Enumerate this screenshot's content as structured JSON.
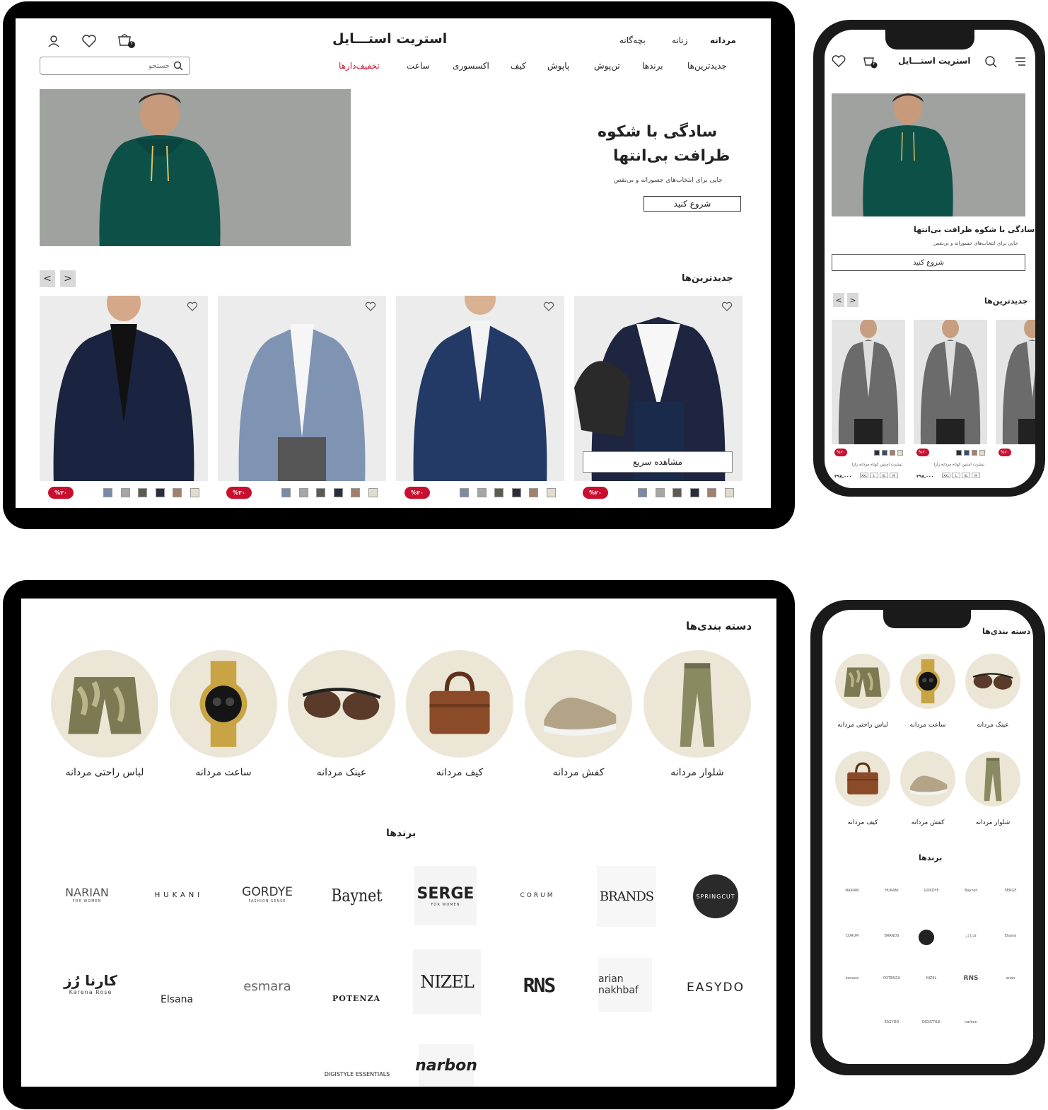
{
  "desktop": {
    "store_name": "استریت استـــایل",
    "top_nav": [
      "مردانه",
      "زنانه",
      "بچه‌گانه"
    ],
    "search_placeholder": "جستجو",
    "cart_count": "۲",
    "main_nav": [
      "جدیدترین‌ها",
      "برندها",
      "تن‌پوش",
      "پاپوش",
      "کیف",
      "اکسسوری",
      "ساعت",
      "تخفیف‌دارها"
    ],
    "hero": {
      "title_line1": "سادگی با شکوه",
      "title_line2": "ظرافت بی‌انتها",
      "subtitle": "جایی برای انتخاب‌های جسورانه و بی‌نقص",
      "cta": "شروع کنید"
    },
    "newest": {
      "heading": "جدیدترین‌ها",
      "prev": "<",
      "next": ">",
      "quick_view": "مشاهده سریع",
      "discount": "%۲۰",
      "swatch_colors": [
        "#7b8aa6",
        "#a6a6a6",
        "#5b5b52",
        "#2a2e3c",
        "#a37f6d",
        "#e2dccc"
      ]
    }
  },
  "mobile_top": {
    "store_name": "استریت استـــایل",
    "cart_count": "۲",
    "hero_title": "سادگی با شکوه ظرافت بی‌انتها",
    "hero_subtitle": "جایی برای انتخاب‌های جسورانه و بی‌نقص",
    "cta": "شروع کنید",
    "newest_heading": "جدیدترین‌ها",
    "discount": "%۲۰",
    "product_name": "تیشرت آستین کوتاه مردانه زارا",
    "price": "۳۹۸,۰۰۰",
    "sizes": [
      "XXL",
      "L",
      "XL",
      "M"
    ]
  },
  "categories_page": {
    "heading": "دسته بندی‌ها",
    "categories": [
      "شلوار مردانه",
      "کفش مردانه",
      "کیف مردانه",
      "عینک مردانه",
      "ساعت مردانه",
      "لباس راحتی مردانه"
    ],
    "brands_heading": "برندها",
    "brands_row1": [
      "SPRINGCUT",
      "BRANDS",
      "CORUM",
      "SERGE",
      "Baynet",
      "GORDYE",
      "HUKANI",
      "NARIAN"
    ],
    "brands_row1_sub": {
      "SERGE": "FOR WOMEN",
      "GORDYE": "FASHION SENSE",
      "NARIAN": "FOR WOMEN"
    },
    "brands_row2": [
      "EASYDO",
      "arian nakhbaf",
      "RNS",
      "NIZEL",
      "POTENZA",
      "esmara",
      "Elsana",
      "کارنا رُز"
    ],
    "karena_sub": "Karena Rose",
    "brands_row3": [
      "narbon",
      "DIGISTYLE ESSENTIALS"
    ]
  },
  "mobile_bottom": {
    "heading": "دسته بندی‌ها",
    "categories": [
      "عینک مردانه",
      "ساعت مردانه",
      "لباس راحتی مردانه",
      "شلوار مردانه",
      "کفش مردانه",
      "کیف مردانه"
    ],
    "brands_heading": "برندها",
    "brand_grid": [
      [
        "SERGE",
        "Baynet",
        "GORDYE",
        "HUKANI",
        "NARIAN"
      ],
      [
        "Elsana",
        "کارنا رُز",
        "SPRINGCUT",
        "BRANDS",
        "CORUM"
      ],
      [
        "arian",
        "RNS",
        "NIZEL",
        "POTENZA",
        "esmara"
      ],
      [
        "narbon",
        "DIGISTYLE",
        "EASYDO"
      ]
    ]
  }
}
